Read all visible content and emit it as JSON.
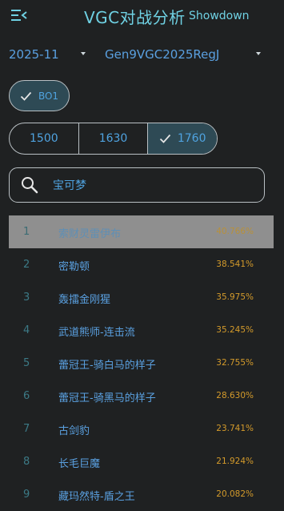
{
  "header": {
    "title": "VGC对战分析",
    "subtitle": "Showdown",
    "menu_icon": "menu-collapse-icon"
  },
  "filters": {
    "month": "2025-11",
    "format": "Gen9VGC2025RegJ"
  },
  "chip": {
    "label": "BO1",
    "selected": true
  },
  "ratings": [
    {
      "label": "1500",
      "selected": false
    },
    {
      "label": "1630",
      "selected": false
    },
    {
      "label": "1760",
      "selected": true
    }
  ],
  "search": {
    "placeholder": "宝可梦"
  },
  "list": [
    {
      "rank": "1",
      "name": "索财灵雷伊布",
      "pct": "40.766%",
      "selected": true
    },
    {
      "rank": "2",
      "name": "密勒顿",
      "pct": "38.541%",
      "selected": false
    },
    {
      "rank": "3",
      "name": "轰擂金刚猩",
      "pct": "35.975%",
      "selected": false
    },
    {
      "rank": "4",
      "name": "武道熊师-连击流",
      "pct": "35.245%",
      "selected": false
    },
    {
      "rank": "5",
      "name": "蕾冠王-骑白马的样子",
      "pct": "32.755%",
      "selected": false
    },
    {
      "rank": "6",
      "name": "蕾冠王-骑黑马的样子",
      "pct": "28.630%",
      "selected": false
    },
    {
      "rank": "7",
      "name": "古剑豹",
      "pct": "23.741%",
      "selected": false
    },
    {
      "rank": "8",
      "name": "长毛巨魔",
      "pct": "21.924%",
      "selected": false
    },
    {
      "rank": "9",
      "name": "藏玛然特-盾之王",
      "pct": "20.082%",
      "selected": false
    }
  ],
  "colors": {
    "accent": "#6fd1e3",
    "link": "#4fa3e0",
    "percent": "#d49b2b",
    "selected_bg": "#2e4a55"
  }
}
